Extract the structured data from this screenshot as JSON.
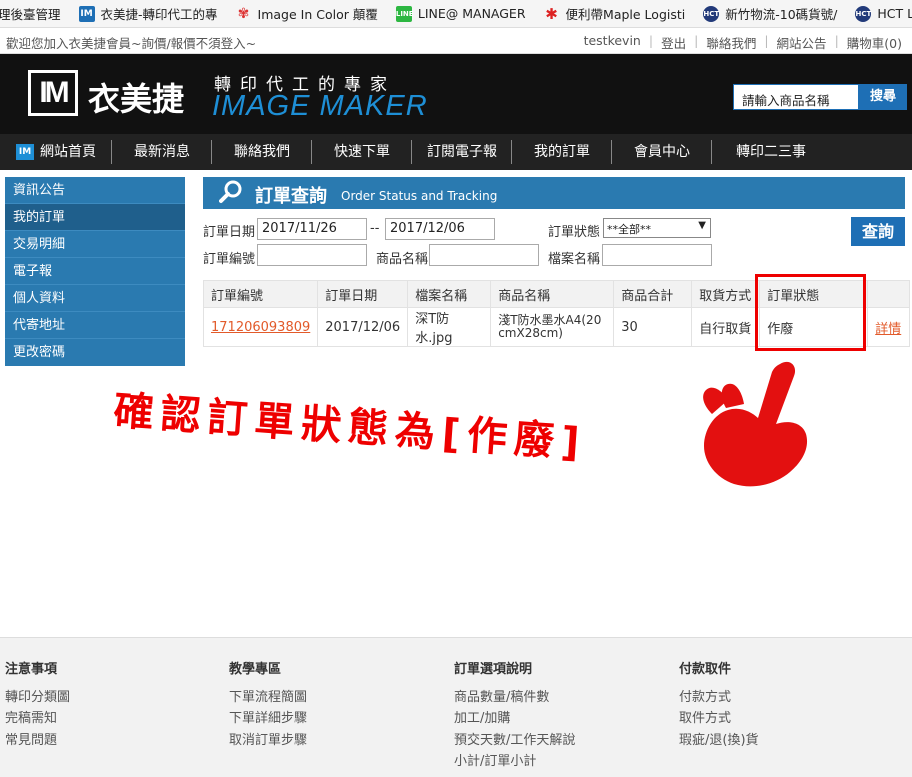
{
  "bookmarks": [
    {
      "label": "理後臺管理",
      "icon": "bookmark-text"
    },
    {
      "label": "衣美捷-轉印代工的專",
      "icon": "im-logo-icon"
    },
    {
      "label": "Image In Color 顛覆",
      "icon": "flower-icon"
    },
    {
      "label": "LINE@ MANAGER",
      "icon": "line-icon"
    },
    {
      "label": "便利帶Maple Logisti",
      "icon": "maple-leaf-icon"
    },
    {
      "label": "新竹物流-10碼貨號/",
      "icon": "hct-icon"
    },
    {
      "label": "HCT Logstics Hsinc",
      "icon": "hct-icon"
    }
  ],
  "util": {
    "welcome": "歡迎您加入衣美捷會員~詢價/報價不須登入~",
    "links": [
      "testkevin",
      "登出",
      "聯絡我們",
      "網站公告",
      "購物車(0)"
    ]
  },
  "header": {
    "logo_mark": "IM",
    "logo_cn": "衣美捷",
    "logo_sub": "轉印代工的專家",
    "logo_en": "IMAGE MAKER",
    "search_placeholder": "請輸入商品名稱",
    "search_button": "搜尋"
  },
  "nav": [
    "網站首頁",
    "最新消息",
    "聯絡我們",
    "快速下單",
    "訂閱電子報",
    "我的訂單",
    "會員中心",
    "轉印二三事"
  ],
  "sidebar": [
    "資訊公告",
    "我的訂單",
    "交易明細",
    "電子報",
    "個人資料",
    "代寄地址",
    "更改密碼"
  ],
  "title": {
    "zh": "訂單查詢",
    "en": "Order Status and Tracking"
  },
  "filter": {
    "order_date_label": "訂單日期",
    "date_from": "2017/11/26",
    "date_sep": "--",
    "date_to": "2017/12/06",
    "status_label": "訂單狀態",
    "status_value": "**全部**",
    "order_no_label": "訂單編號",
    "product_label": "商品名稱",
    "file_label": "檔案名稱",
    "query_button": "查詢"
  },
  "table": {
    "headers": [
      "訂單編號",
      "訂單日期",
      "檔案名稱",
      "商品名稱",
      "商品合計",
      "取貨方式",
      "訂單狀態",
      ""
    ],
    "rows": [
      {
        "order_no": "171206093809",
        "date": "2017/12/06",
        "file": "深T防水.jpg",
        "product": "淺T防水墨水A4(20cmX28cm)",
        "total": "30",
        "pickup": "自行取貨",
        "status": "作廢",
        "detail": "詳情"
      }
    ]
  },
  "annotation": "確認訂單狀態為[作廢]",
  "colors": {
    "accent": "#1e6fb5",
    "sidebar": "#2a7ab0",
    "highlight": "#e00000",
    "link": "#e25a2a"
  },
  "footer": [
    {
      "heading": "注意事項",
      "items": [
        "轉印分類圖",
        "完稿需知",
        "常見問題"
      ]
    },
    {
      "heading": "教學專區",
      "items": [
        "下單流程簡圖",
        "下單詳細步驟",
        "取消訂單步驟"
      ]
    },
    {
      "heading": "訂單選項說明",
      "items": [
        "商品數量/稿件數",
        "加工/加購",
        "預交天數/工作天解說",
        "小計/訂單小計"
      ]
    },
    {
      "heading": "付款取件",
      "items": [
        "付款方式",
        "取件方式",
        "瑕疵/退(換)貨"
      ]
    }
  ]
}
